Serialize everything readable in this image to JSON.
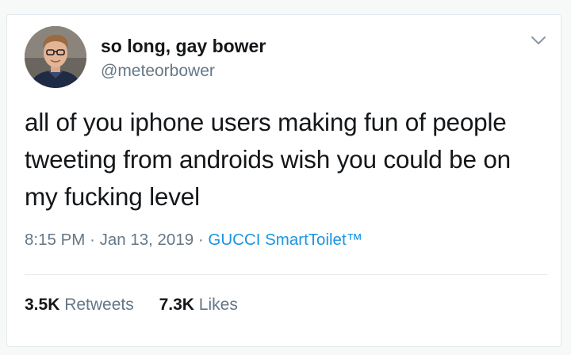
{
  "tweet": {
    "display_name": "so long, gay bower",
    "handle": "@meteorbower",
    "text": "all of you iphone users making fun of people tweeting from androids wish you could be on my fucking level",
    "time": "8:15 PM",
    "date": "Jan 13, 2019",
    "separator": "·",
    "source": "GUCCI SmartToilet™",
    "retweets_count": "3.5K",
    "retweets_label": "Retweets",
    "likes_count": "7.3K",
    "likes_label": "Likes"
  },
  "icons": {
    "menu": "chevron-down-icon"
  },
  "colors": {
    "text": "#14171a",
    "secondary": "#657786",
    "link": "#1b95e0",
    "border": "#e1e8ed"
  }
}
